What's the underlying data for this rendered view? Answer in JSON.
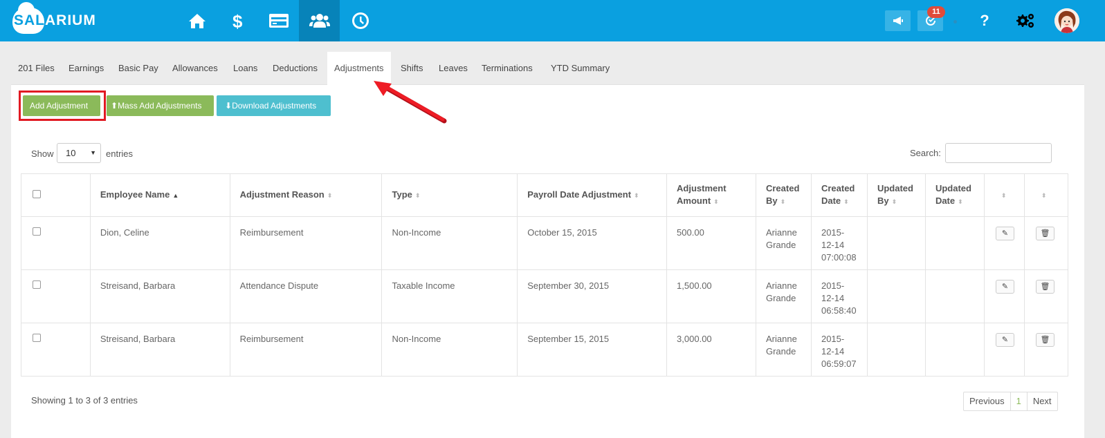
{
  "app": {
    "logo_prefix": "SAL",
    "logo_suffix": "ARIUM",
    "notification_count": "11",
    "help_label": "?"
  },
  "nav": [
    {
      "name": "home",
      "icon": "home-icon"
    },
    {
      "name": "payroll",
      "icon": "dollar-icon"
    },
    {
      "name": "payments",
      "icon": "credit-card-icon"
    },
    {
      "name": "employees",
      "icon": "users-icon",
      "active": true
    },
    {
      "name": "timekeeping",
      "icon": "clock-icon"
    }
  ],
  "tabs": [
    "201 Files",
    "Earnings",
    "Basic Pay",
    "Allowances",
    "Loans",
    "Deductions",
    "Adjustments",
    "Shifts",
    "Leaves",
    "Terminations",
    "YTD Summary"
  ],
  "active_tab": "Adjustments",
  "toolbar": {
    "add_label": "Add Adjustment",
    "mass_add_label": "Mass Add Adjustments",
    "download_label": "Download Adjustments"
  },
  "length": {
    "show_label": "Show",
    "value": "10",
    "entries_label": "entries"
  },
  "search": {
    "label": "Search:"
  },
  "table": {
    "headers": [
      "Employee Name",
      "Adjustment Reason",
      "Type",
      "Payroll Date Adjustment",
      "Adjustment Amount",
      "Created By",
      "Created Date",
      "Updated By",
      "Updated Date"
    ],
    "rows": [
      {
        "employee": "Dion, Celine",
        "reason": "Reimbursement",
        "type": "Non-Income",
        "payroll_date": "October 15, 2015",
        "amount": "500.00",
        "created_by": "Arianne Grande",
        "created_date": "2015-12-14 07:00:08",
        "updated_by": "",
        "updated_date": ""
      },
      {
        "employee": "Streisand, Barbara",
        "reason": "Attendance Dispute",
        "type": "Taxable Income",
        "payroll_date": "September 30, 2015",
        "amount": "1,500.00",
        "created_by": "Arianne Grande",
        "created_date": "2015-12-14 06:58:40",
        "updated_by": "",
        "updated_date": ""
      },
      {
        "employee": "Streisand, Barbara",
        "reason": "Reimbursement",
        "type": "Non-Income",
        "payroll_date": "September 15, 2015",
        "amount": "3,000.00",
        "created_by": "Arianne Grande",
        "created_date": "2015-12-14 06:59:07",
        "updated_by": "",
        "updated_date": ""
      }
    ]
  },
  "summary": "Showing 1 to 3 of 3 entries",
  "pager": {
    "prev": "Previous",
    "current": "1",
    "next": "Next"
  },
  "colors": {
    "brand": "#0aa0e0",
    "green": "#8bba5a",
    "teal": "#4ebfcf",
    "highlight": "#e11a22"
  }
}
